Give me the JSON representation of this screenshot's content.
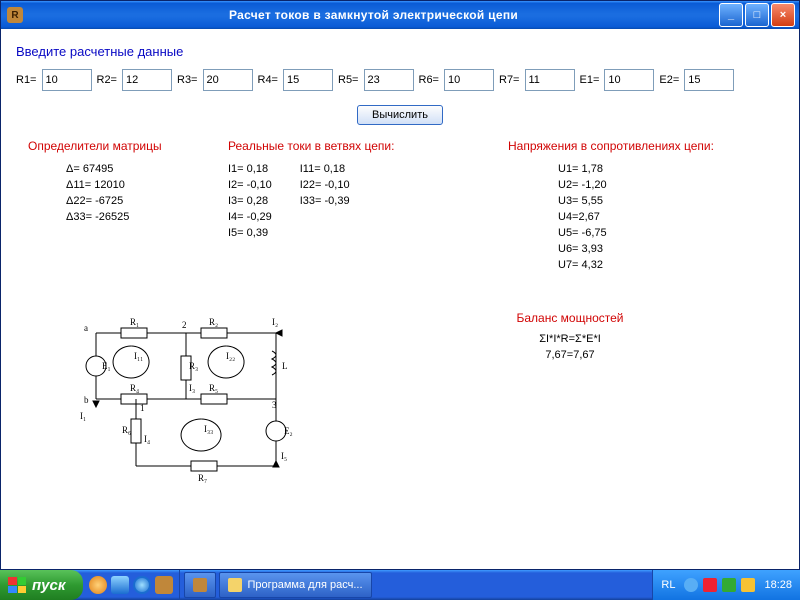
{
  "window": {
    "title": "Расчет токов в замкнутой электрической цепи"
  },
  "heading": "Введите  расчетные данные",
  "inputs": {
    "labels": [
      "R1=",
      "R2=",
      "R3=",
      "R4=",
      "R5=",
      "R6=",
      "R7=",
      "E1=",
      "E2="
    ],
    "values": [
      "10",
      "12",
      "20",
      "15",
      "23",
      "10",
      "11",
      "10",
      "15"
    ]
  },
  "calc_label": "Вычислить",
  "sections": {
    "det": {
      "title": "Определители матрицы",
      "lines": [
        "Δ= 67495",
        "Δ11= 12010",
        "Δ22= -6725",
        "Δ33= -26525"
      ]
    },
    "currents": {
      "title": "Реальные токи в ветвях цепи:",
      "col1": [
        "I1= 0,18",
        "I2= -0,10",
        "I3= 0,28",
        "I4= -0,29",
        "I5= 0,39"
      ],
      "col2": [
        "I11= 0,18",
        "I22= -0,10",
        "I33= -0,39"
      ]
    },
    "voltages": {
      "title": "Напряжения в сопротивлениях цепи:",
      "lines": [
        "U1= 1,78",
        "U2= -1,20",
        "U3= 5,55",
        "U4=2,67",
        "U5= -6,75",
        "U6= 3,93",
        "U7= 4,32"
      ]
    }
  },
  "balance": {
    "title": "Баланс мощностей",
    "formula": "ΣI*I*R=Σ*E*I",
    "result": "7,67=7,67"
  },
  "taskbar": {
    "start": "пуск",
    "task1": "Программа для расч...",
    "lang": "RL",
    "clock": "18:28"
  }
}
